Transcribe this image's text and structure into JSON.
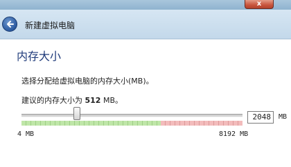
{
  "window": {
    "close_glyph": "x"
  },
  "nav": {
    "title": "新建虚拟电脑",
    "back_icon": "back-arrow-icon"
  },
  "page": {
    "title": "内存大小",
    "description": "选择分配给虚拟电脑的内存大小(MB)。",
    "recommendation_prefix": "建议的内存大小为 ",
    "recommendation_value": "512",
    "recommendation_suffix": " MB。"
  },
  "memory": {
    "value": "2048",
    "unit": "MB",
    "min_label": "4 MB",
    "max_label": "8192 MB",
    "slider_fraction": 0.25,
    "safe_fraction": 0.63,
    "colors": {
      "safe": "#bfe6a8",
      "danger": "#f3bcbc"
    }
  }
}
